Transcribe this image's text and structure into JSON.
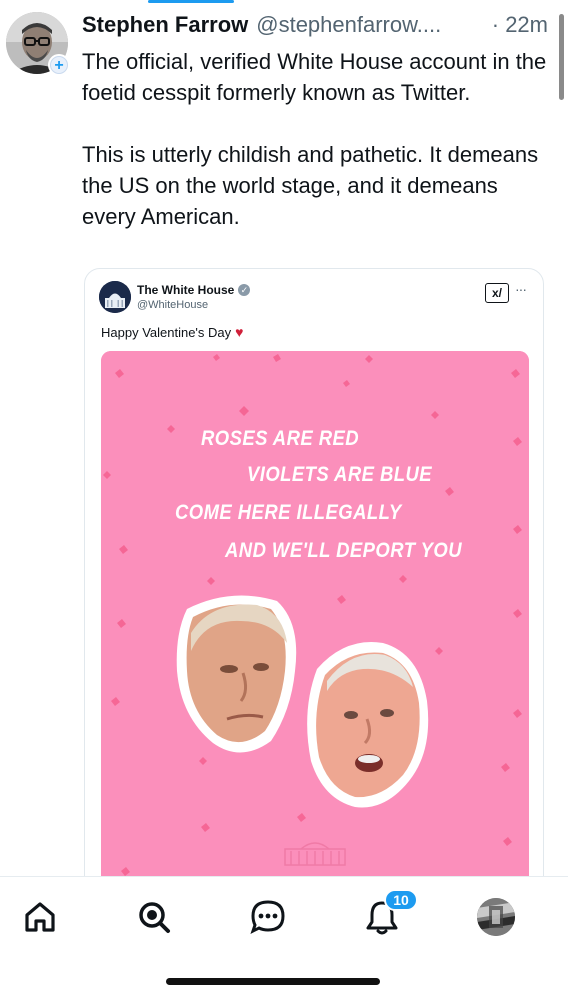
{
  "post": {
    "author_name": "Stephen Farrow",
    "author_handle": "@stephenfarrow....",
    "timestamp": "· 22m",
    "follow_symbol": "+",
    "text_para_1": "The official, verified White House account in the foetid cesspit formerly known as Twitter.",
    "text_para_2": "This is utterly childish and pathetic. It demeans the US on the world stage, and it demeans every American."
  },
  "quoted_post": {
    "author_name": "The White House",
    "author_handle": "@WhiteHouse",
    "text": "Happy Valentine's Day",
    "grok_label": "x/",
    "more_label": "···",
    "image": {
      "background_color": "#fb8fbb",
      "poem": [
        "ROSES ARE RED",
        "VIOLETS ARE BLUE",
        "COME HERE ILLEGALLY",
        "AND WE'LL DEPORT YOU"
      ]
    }
  },
  "nav": {
    "items": [
      "home-icon",
      "explore-icon",
      "messages-icon",
      "notifications-icon",
      "profile-avatar"
    ],
    "notification_count": "10"
  },
  "colors": {
    "accent": "#1d9bf0",
    "text": "#0f1419",
    "secondary_text": "#536471",
    "heart": "#d0203a",
    "card_pink": "#fb8fbb"
  }
}
